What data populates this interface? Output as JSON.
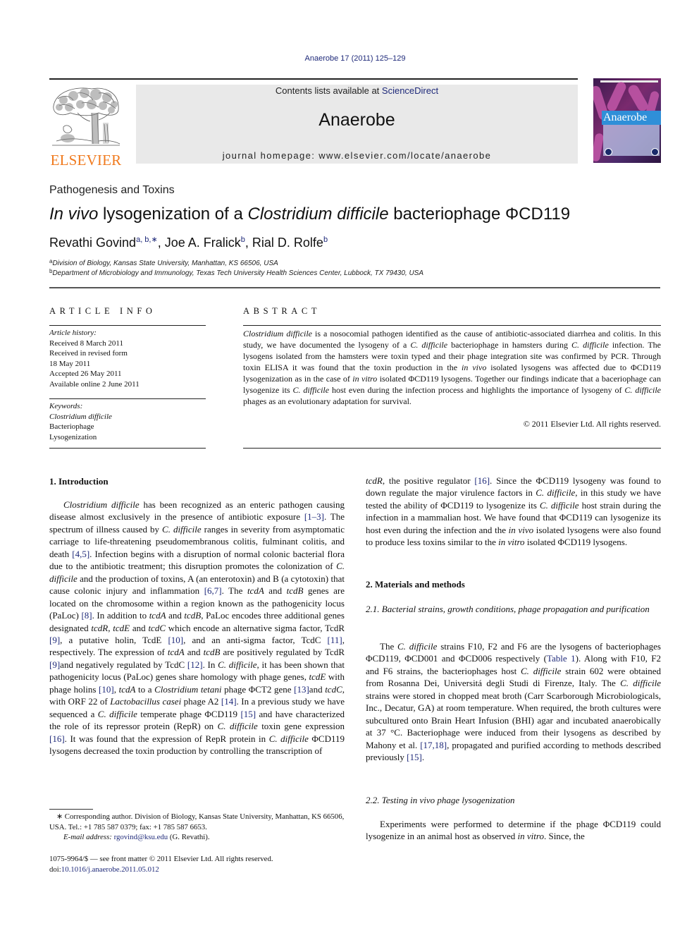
{
  "journal_citation": "Anaerobe 17 (2011) 125–129",
  "header": {
    "publisher_logo_text": "ELSEVIER",
    "contents_prefix": "Contents lists available at ",
    "contents_link": "ScienceDirect",
    "journal_name": "Anaerobe",
    "homepage": "journal homepage: www.elsevier.com/locate/anaerobe",
    "cover_title": "Anaerobe"
  },
  "colors": {
    "link": "#1f2a7a",
    "elsevier_orange": "#f07a1e",
    "banner_bg": "#e9e9e9",
    "cover_band": "#2f8fd8"
  },
  "article": {
    "section": "Pathogenesis and Toxins",
    "title": [
      {
        "t": "In vivo",
        "i": true
      },
      {
        "t": " lysogenization of a "
      },
      {
        "t": "Clostridium difficile",
        "i": true
      },
      {
        "t": " bacteriophage ΦCD119"
      }
    ],
    "authors": [
      {
        "name": "Revathi Govind",
        "sup": "a, b,∗",
        "sep": ", "
      },
      {
        "name": "Joe A. Fralick",
        "sup": "b",
        "sep": ", "
      },
      {
        "name": "Rial D. Rolfe",
        "sup": "b",
        "sep": ""
      }
    ],
    "affiliations": [
      {
        "mark": "a",
        "text": "Division of Biology, Kansas State University, Manhattan, KS 66506, USA"
      },
      {
        "mark": "b",
        "text": "Department of Microbiology and Immunology, Texas Tech University Health Sciences Center, Lubbock, TX 79430, USA"
      }
    ]
  },
  "article_info": {
    "heading": "ARTICLE INFO",
    "history_label": "Article history:",
    "history": [
      "Received 8 March 2011",
      "Received in revised form",
      "18 May 2011",
      "Accepted 26 May 2011",
      "Available online 2 June 2011"
    ],
    "keywords_label": "Keywords:",
    "keywords": [
      {
        "t": "Clostridium difficile",
        "i": true
      },
      {
        "t": "Bacteriophage"
      },
      {
        "t": "Lysogenization"
      }
    ]
  },
  "abstract": {
    "heading": "ABSTRACT",
    "body": [
      {
        "t": "Clostridium difficile",
        "i": true
      },
      {
        "t": " is a nosocomial pathogen identified as the cause of antibiotic-associated diarrhea and colitis. In this study, we have documented the lysogeny of a "
      },
      {
        "t": "C. difficile",
        "i": true
      },
      {
        "t": " bacteriophage in hamsters during "
      },
      {
        "t": "C. difficile",
        "i": true
      },
      {
        "t": " infection. The lysogens isolated from the hamsters were toxin typed and their phage inte­gration site was confirmed by PCR. Through toxin ELISA it was found that the toxin production in the "
      },
      {
        "t": "in vivo",
        "i": true
      },
      {
        "t": " isolated lysogens was affected due to ΦCD119 lysogenization as in the case of "
      },
      {
        "t": "in vitro",
        "i": true
      },
      {
        "t": " isolated ΦCD119 lysogens. Together our findings indicate that a baceriophage can lysogenize its "
      },
      {
        "t": "C. difficile",
        "i": true
      },
      {
        "t": " host even during the infection process and highlights the importance of lysogeny of "
      },
      {
        "t": "C. difficile",
        "i": true
      },
      {
        "t": " phages as an evolutionary adaptation for survival."
      }
    ],
    "copyright": "© 2011 Elsevier Ltd. All rights reserved."
  },
  "introduction": {
    "heading": "1.  Introduction",
    "body": [
      {
        "t": "Clostridium difficile",
        "i": true
      },
      {
        "t": " has been recognized as an enteric pathogen causing disease almost exclusively in the presence of antibiotic exposure "
      },
      {
        "t": "[1–3]",
        "link": true
      },
      {
        "t": ". The spectrum of illness caused by "
      },
      {
        "t": "C. difficile",
        "i": true
      },
      {
        "t": " ranges in severity from asymptomatic carriage to life-threatening pseu­domembranous colitis, fulminant colitis, and death "
      },
      {
        "t": "[4,5]",
        "link": true
      },
      {
        "t": ". Infection begins with a disruption of normal colonic bacterial flora due to the antibiotic treatment; this disruption promotes the colonization of "
      },
      {
        "t": "C. difficile",
        "i": true
      },
      {
        "t": " and the production of toxins, A (an enterotoxin) and B (a cytotoxin) that cause colonic injury and inflammation "
      },
      {
        "t": "[6,7]",
        "link": true
      },
      {
        "t": ". The "
      },
      {
        "t": "tcdA",
        "i": true
      },
      {
        "t": " and "
      },
      {
        "t": "tcdB",
        "i": true
      },
      {
        "t": " genes are located on the chromosome within a region known as the pathogenicity locus (PaLoc) "
      },
      {
        "t": "[8]",
        "link": true
      },
      {
        "t": ". In addition to "
      },
      {
        "t": "tcdA",
        "i": true
      },
      {
        "t": " and "
      },
      {
        "t": "tcdB",
        "i": true
      },
      {
        "t": ", PaLoc encodes three additional genes designated "
      },
      {
        "t": "tcdR",
        "i": true
      },
      {
        "t": ", "
      },
      {
        "t": "tcdE",
        "i": true
      },
      {
        "t": " and "
      },
      {
        "t": "tcdC",
        "i": true
      },
      {
        "t": " which encode an alternative sigma factor, TcdR "
      },
      {
        "t": "[9]",
        "link": true
      },
      {
        "t": ", a putative holin, TcdE "
      },
      {
        "t": "[10]",
        "link": true
      },
      {
        "t": ", and an anti-sigma factor, TcdC "
      },
      {
        "t": "[11]",
        "link": true
      },
      {
        "t": ", respectively. The expression of "
      },
      {
        "t": "tcdA",
        "i": true
      },
      {
        "t": " and "
      },
      {
        "t": "tcdB",
        "i": true
      },
      {
        "t": " are positively regulated by TcdR "
      },
      {
        "t": "[9]",
        "link": true
      },
      {
        "t": "and negatively regulated by TcdC "
      },
      {
        "t": "[12]",
        "link": true
      },
      {
        "t": ". In "
      },
      {
        "t": "C. difficile",
        "i": true
      },
      {
        "t": ", it has been shown that pathogenicity locus (PaLoc) genes share homology with phage genes, "
      },
      {
        "t": "tcdE",
        "i": true
      },
      {
        "t": " with phage holins "
      },
      {
        "t": "[10]",
        "link": true
      },
      {
        "t": ", "
      },
      {
        "t": "tcdA",
        "i": true
      },
      {
        "t": " to a "
      },
      {
        "t": "Clostridium tetani",
        "i": true
      },
      {
        "t": " phage ΦCT2 gene "
      },
      {
        "t": "[13]",
        "link": true
      },
      {
        "t": "and "
      },
      {
        "t": "tcdC",
        "i": true
      },
      {
        "t": ", with ORF 22 of "
      },
      {
        "t": "Lactobacillus casei",
        "i": true
      },
      {
        "t": " phage A2 "
      },
      {
        "t": "[14]",
        "link": true
      },
      {
        "t": ". In a previous study we have sequenced a "
      },
      {
        "t": "C. difficile",
        "i": true
      },
      {
        "t": " temperate phage ΦCD119 "
      },
      {
        "t": "[15]",
        "link": true
      },
      {
        "t": " and have characterized the role of its repressor protein (RepR) on "
      },
      {
        "t": "C. difficile",
        "i": true
      },
      {
        "t": " toxin gene expression "
      },
      {
        "t": "[16]",
        "link": true
      },
      {
        "t": ". It was found that the expression of RepR protein in "
      },
      {
        "t": "C. difficile",
        "i": true
      },
      {
        "t": " ΦCD119 lysogens decreased the toxin production by controlling the transcription of"
      }
    ],
    "continuation": [
      {
        "t": "tcdR",
        "i": true
      },
      {
        "t": ", the positive regulator "
      },
      {
        "t": "[16]",
        "link": true
      },
      {
        "t": ". Since the ΦCD119 lysogeny was found to down regulate the major virulence factors in "
      },
      {
        "t": "C. difficile",
        "i": true
      },
      {
        "t": ", in this study we have tested the ability of ΦCD119 to lysogenize its "
      },
      {
        "t": "C. difficile",
        "i": true
      },
      {
        "t": " host strain during the infection in a mammalian host. We have found that ΦCD119 can lysogenize its host even during the infection and the "
      },
      {
        "t": "in vivo",
        "i": true
      },
      {
        "t": " isolated lysogens were also found to produce less toxins similar to the "
      },
      {
        "t": "in vitro",
        "i": true
      },
      {
        "t": " isolated ΦCD119 lysogens."
      }
    ]
  },
  "methods": {
    "heading": "2.  Materials and methods",
    "sub1_heading": "2.1.  Bacterial strains, growth conditions, phage propagation and purification",
    "sub1_body": [
      {
        "t": "The "
      },
      {
        "t": "C. difficile",
        "i": true
      },
      {
        "t": " strains F10, F2 and F6 are the lysogens of bacte­riophages ΦCD119, ΦCD001 and ΦCD006 respectively ("
      },
      {
        "t": "Table 1",
        "link": true
      },
      {
        "t": "). Along with F10, F2 and F6 strains, the bacteriophages host "
      },
      {
        "t": "C. difficile",
        "i": true
      },
      {
        "t": " strain 602 were obtained from Rosanna Dei, Universitá degli Studi di Firenze, Italy. The "
      },
      {
        "t": "C. difficile",
        "i": true
      },
      {
        "t": " strains were stored in chopped meat broth (Carr Scarborough Microbiologicals, Inc., Decatur, GA) at room temperature. When required, the broth cultures were sub­cultured onto Brain Heart Infusion (BHI) agar and incubated anaerobically at 37 °C. Bacteriophage were induced from their lysogens as described by Mahony et al. "
      },
      {
        "t": "[17,18]",
        "link": true
      },
      {
        "t": ", propagated and purified according to methods described previously "
      },
      {
        "t": "[15]",
        "link": true
      },
      {
        "t": "."
      }
    ],
    "sub2_heading": "2.2.  Testing in vivo phage lysogenization",
    "sub2_body": [
      {
        "t": "Experiments were performed to determine if the phage ΦCD119 could lysogenize in an animal host as observed "
      },
      {
        "t": "in vitro",
        "i": true
      },
      {
        "t": ". Since, the"
      }
    ]
  },
  "footnote": {
    "corresponding": "∗ Corresponding author. Division of Biology, Kansas State University, Manhattan, KS 66506, USA. Tel.: +1 785 587 0379; fax: +1 785 587 6653.",
    "email_label": "E-mail address:",
    "email": "rgovind@ksu.edu",
    "email_suffix": " (G. Revathi)."
  },
  "front_matter": {
    "issn_line": "1075-9964/$ — see front matter © 2011 Elsevier Ltd. All rights reserved.",
    "doi_prefix": "doi:",
    "doi": "10.1016/j.anaerobe.2011.05.012"
  }
}
